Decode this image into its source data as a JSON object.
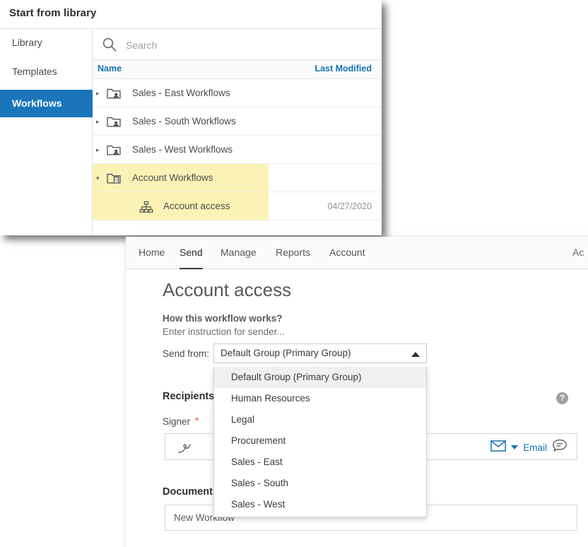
{
  "library_window": {
    "title": "Start from library",
    "search": {
      "placeholder": "Search",
      "value": "",
      "icon": "search-icon"
    },
    "sidebar": {
      "items": [
        {
          "label": "Library",
          "selected": false
        },
        {
          "label": "Templates",
          "selected": false
        },
        {
          "label": "Workflows",
          "selected": true
        }
      ]
    },
    "columns": {
      "name": "Name",
      "last_modified": "Last Modified"
    },
    "rows": [
      {
        "name": "Sales - East Workflows",
        "date": "",
        "icon": "folder-group-icon",
        "twisty": "▸",
        "expanded": false,
        "highlighted": false,
        "child": false
      },
      {
        "name": "Sales - South Workflows",
        "date": "",
        "icon": "folder-group-icon",
        "twisty": "▸",
        "expanded": false,
        "highlighted": false,
        "child": false
      },
      {
        "name": "Sales - West Workflows",
        "date": "",
        "icon": "folder-group-icon",
        "twisty": "▸",
        "expanded": false,
        "highlighted": false,
        "child": false
      },
      {
        "name": "Account Workflows",
        "date": "",
        "icon": "folder-account-icon",
        "twisty": "▾",
        "expanded": true,
        "highlighted": true,
        "child": false
      },
      {
        "name": "Account access",
        "date": "04/27/2020",
        "icon": "workflow-node-icon",
        "twisty": "",
        "expanded": false,
        "highlighted": true,
        "child": true
      }
    ],
    "colors": {
      "selected_nav": "#1a75bb",
      "link": "#1473b0",
      "highlight_row": "#fbf3b5"
    }
  },
  "send_window": {
    "nav": {
      "tabs": [
        {
          "label": "Home",
          "active": false
        },
        {
          "label": "Send",
          "active": true
        },
        {
          "label": "Manage",
          "active": false
        },
        {
          "label": "Reports",
          "active": false
        },
        {
          "label": "Account",
          "active": false
        }
      ],
      "right_partial": "Ac"
    },
    "workflow": {
      "title": "Account access",
      "how_it_works": "How this workflow works?",
      "instruction": "Enter instruction for sender...",
      "send_from_label": "Send from:",
      "send_from_value": "Default Group (Primary Group)"
    },
    "recipients": {
      "heading": "Recipients",
      "help_glyph": "?",
      "signer_label": "Signer",
      "required_mark": "*",
      "signer_value": "",
      "signer_icon": "signature-pen-icon",
      "delivery_label": "Email",
      "delivery_icon": "envelope-icon",
      "delivery_chevron_icon": "chevron-down-icon",
      "message_icon": "speech-bubble-icon"
    },
    "documents": {
      "heading": "Documents",
      "items": [
        {
          "name": "New Workflow"
        }
      ]
    }
  },
  "dropdown": {
    "open": true,
    "options": [
      {
        "label": "Default Group (Primary Group)",
        "selected": true
      },
      {
        "label": "Human Resources",
        "selected": false
      },
      {
        "label": "Legal",
        "selected": false
      },
      {
        "label": "Procurement",
        "selected": false
      },
      {
        "label": "Sales - East",
        "selected": false
      },
      {
        "label": "Sales - South",
        "selected": false
      },
      {
        "label": "Sales - West",
        "selected": false
      }
    ]
  }
}
